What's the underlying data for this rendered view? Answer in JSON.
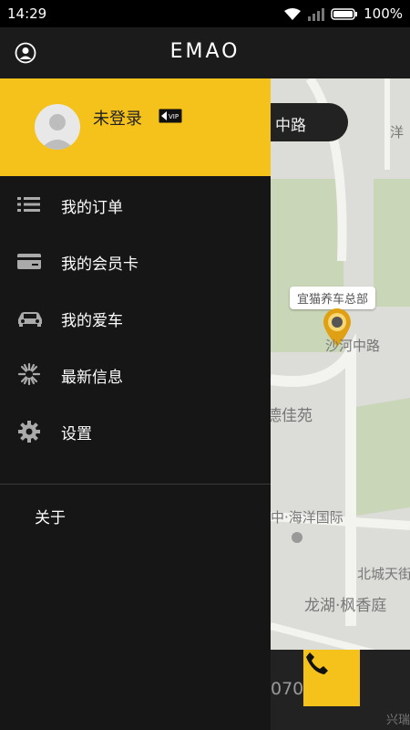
{
  "status_bar": {
    "time": "14:29",
    "battery": "100%"
  },
  "app": {
    "logo": "EMAO"
  },
  "drawer": {
    "username": "未登录",
    "vip_badge": "VIP",
    "menu": [
      {
        "label": "我的订单",
        "icon": "list-icon"
      },
      {
        "label": "我的会员卡",
        "icon": "card-icon"
      },
      {
        "label": "我的爱车",
        "icon": "car-icon"
      },
      {
        "label": "最新信息",
        "icon": "burst-icon"
      },
      {
        "label": "设置",
        "icon": "gear-icon"
      }
    ],
    "about": "关于"
  },
  "map": {
    "search_fragment": "中路",
    "labels": {
      "top_right": "洋",
      "hq_tag": "宜猫养车总部",
      "road": "沙河中路",
      "estate1": "德佳苑",
      "estate2": "中·海洋国际",
      "north": "北城天街",
      "estate3": "龙湖·枫香庭",
      "bottom_right": "兴瑞"
    },
    "phone_fragment": "070"
  },
  "colors": {
    "accent": "#f5c11b",
    "drawer_bg": "#161616"
  }
}
